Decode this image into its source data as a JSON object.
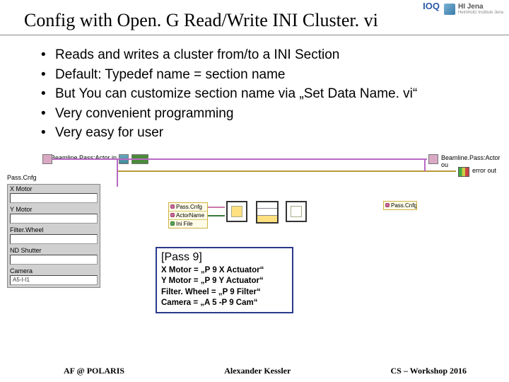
{
  "title": "Config with Open. G Read/Write INI Cluster. vi",
  "header": {
    "logo1": "IOQ",
    "logo2_main": "HI Jena",
    "logo2_sub": "Helmholtz Institute Jena"
  },
  "bullets": [
    "Reads and writes a cluster from/to a INI Section",
    "Default: Typedef name = section name",
    "But You can customize section name via „Set Data Name. vi“",
    "Very convenient programming",
    "Very easy for user"
  ],
  "diagram": {
    "in_label": "Beamline.Pass:Actor in",
    "out_label": "Beamline.Pass:Actor ou",
    "error_out": "error out",
    "panel_label": "Pass.Cnfg",
    "cluster_fields": [
      {
        "label": "X Motor",
        "value": ""
      },
      {
        "label": "Y Motor",
        "value": ""
      },
      {
        "label": "Filter.Wheel",
        "value": ""
      },
      {
        "label": "ND Shutter",
        "value": ""
      },
      {
        "label": "Camera",
        "value": "A5-I-I1"
      }
    ],
    "unbundle": {
      "row1": "Pass.Cnfg",
      "row2": "ActorName",
      "row3": "Ini File"
    }
  },
  "ini": {
    "section": "[Pass 9]",
    "lines": [
      "X Motor = „P 9 X Actuator“",
      "Y Motor = „P 9 Y Actuator“",
      "Filter. Wheel = „P 9 Filter“",
      "Camera = „A 5 -P 9 Cam“"
    ]
  },
  "footer": {
    "left": "AF @ POLARIS",
    "center": "Alexander Kessler",
    "right": "CS – Workshop 2016"
  }
}
